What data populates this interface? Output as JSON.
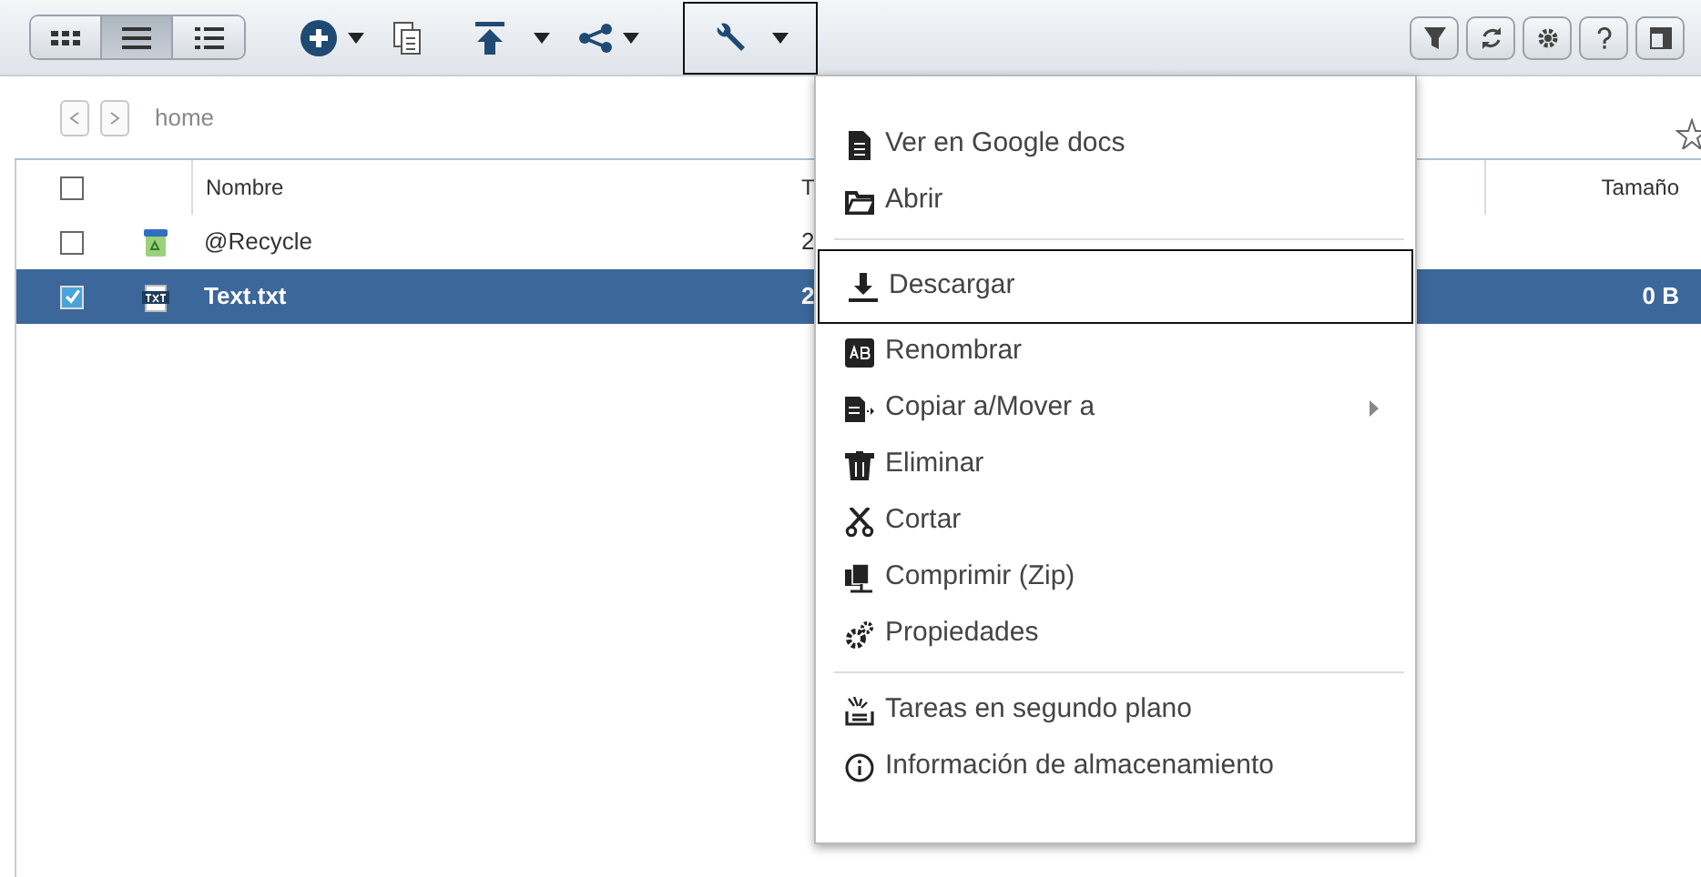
{
  "toolbar": {
    "view_modes": [
      {
        "kind": "grid",
        "selected": false
      },
      {
        "kind": "list",
        "selected": true
      },
      {
        "kind": "details",
        "selected": false
      }
    ],
    "tools_open": true
  },
  "breadcrumb": {
    "path": "home"
  },
  "table": {
    "columns": [
      "Nombre",
      "T",
      "Tamaño"
    ],
    "all_checked": false,
    "rows": [
      {
        "kind": "recycle",
        "name": "@Recycle",
        "column_3": "2",
        "size": "",
        "checked": false,
        "selected": false
      },
      {
        "kind": "txt",
        "name": "Text.txt",
        "column_3": "2",
        "size": "0 B",
        "checked": true,
        "selected": true
      }
    ]
  },
  "menu": [
    {
      "kind": "doc",
      "label": "Ver en Google docs",
      "highlighted": false,
      "submenu": false
    },
    {
      "kind": "folder",
      "label": "Abrir",
      "highlighted": false,
      "submenu": false
    },
    {
      "kind": "separator"
    },
    {
      "kind": "download",
      "label": "Descargar",
      "highlighted": true,
      "submenu": false
    },
    {
      "kind": "rename",
      "label": "Renombrar",
      "highlighted": false,
      "submenu": false
    },
    {
      "kind": "copy",
      "label": "Copiar a/Mover a",
      "highlighted": false,
      "submenu": true
    },
    {
      "kind": "trash",
      "label": "Eliminar",
      "highlighted": false,
      "submenu": false
    },
    {
      "kind": "cut",
      "label": "Cortar",
      "highlighted": false,
      "submenu": false
    },
    {
      "kind": "zip",
      "label": "Comprimir (Zip)",
      "highlighted": false,
      "submenu": false
    },
    {
      "kind": "gears",
      "label": "Propiedades",
      "highlighted": false,
      "submenu": false
    },
    {
      "kind": "separator"
    },
    {
      "kind": "tasks",
      "label": "Tareas en segundo plano",
      "highlighted": false,
      "submenu": false
    },
    {
      "kind": "info",
      "label": "Información de almacenamiento",
      "highlighted": false,
      "submenu": false
    }
  ]
}
